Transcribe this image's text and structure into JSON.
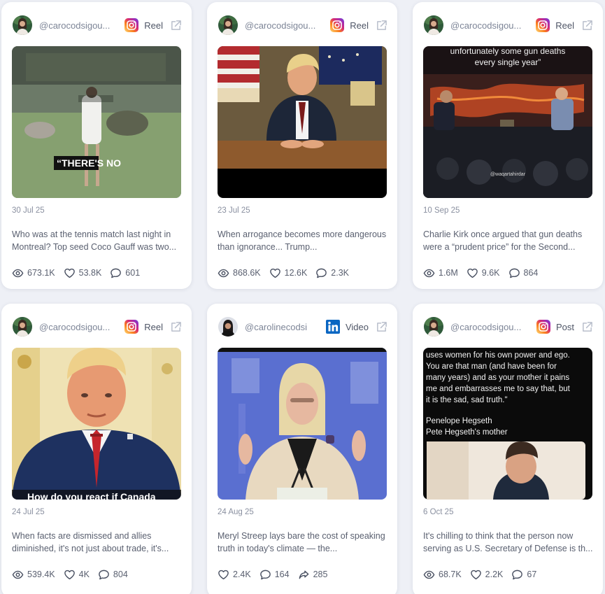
{
  "colors": {
    "background": "#eef0f6",
    "card": "#ffffff",
    "instagram": "#e1306c",
    "linkedin": "#0a66c2"
  },
  "cards": [
    {
      "handle": "@carocodsigou...",
      "platform": "Reel",
      "platform_icon": "instagram-icon",
      "date": "30 Jul 25",
      "description": "Who was at the tennis match last night in Montreal? Top seed Coco Gauff was two...",
      "caption": "“THERE'S NO",
      "stats": {
        "views": "673.1K",
        "likes": "53.8K",
        "comments": "601"
      }
    },
    {
      "handle": "@carocodsigou...",
      "platform": "Reel",
      "platform_icon": "instagram-icon",
      "date": "23 Jul 25",
      "description": "When arrogance becomes more dangerous than ignorance... Trump...",
      "stats": {
        "views": "868.6K",
        "likes": "12.6K",
        "comments": "2.3K"
      }
    },
    {
      "handle": "@carocodsigou...",
      "platform": "Reel",
      "platform_icon": "instagram-icon",
      "date": "10 Sep 25",
      "description": "Charlie Kirk once argued that gun deaths were a “prudent price” for the Second...",
      "caption_line1": "unfortunately some gun deaths",
      "caption_line2": "every single year”",
      "watermark": "@waqartahirdar",
      "stats": {
        "views": "1.6M",
        "likes": "9.6K",
        "comments": "864"
      }
    },
    {
      "handle": "@carocodsigou...",
      "platform": "Reel",
      "platform_icon": "instagram-icon",
      "date": "24 Jul 25",
      "description": "When facts are dismissed and allies diminished, it's not just about trade, it's...",
      "caption": "How do you react if Canada",
      "stats": {
        "views": "539.4K",
        "likes": "4K",
        "comments": "804"
      }
    },
    {
      "handle": "@carolinecodsi",
      "platform": "Video",
      "platform_icon": "linkedin-icon",
      "date": "24 Aug 25",
      "description": "Meryl Streep lays bare the cost of speaking truth in today's climate — the...",
      "stats": {
        "likes": "2.4K",
        "comments": "164",
        "shares": "285"
      }
    },
    {
      "handle": "@carocodsigou...",
      "platform": "Post",
      "platform_icon": "instagram-icon",
      "date": "6 Oct 25",
      "description": "It's chilling to think that the person now serving as U.S. Secretary of Defense is th...",
      "quote_lines": [
        "uses women for his own power and ego.",
        "You are that man (and have been for",
        "many years) and as your mother it pains",
        "me and embarrasses me to say that, but",
        "it is the sad, sad truth.\""
      ],
      "attribution_line1": "Penelope Hegseth",
      "attribution_line2": "Pete Hegseth's mother",
      "stats": {
        "views": "68.7K",
        "likes": "2.2K",
        "comments": "67"
      }
    }
  ]
}
